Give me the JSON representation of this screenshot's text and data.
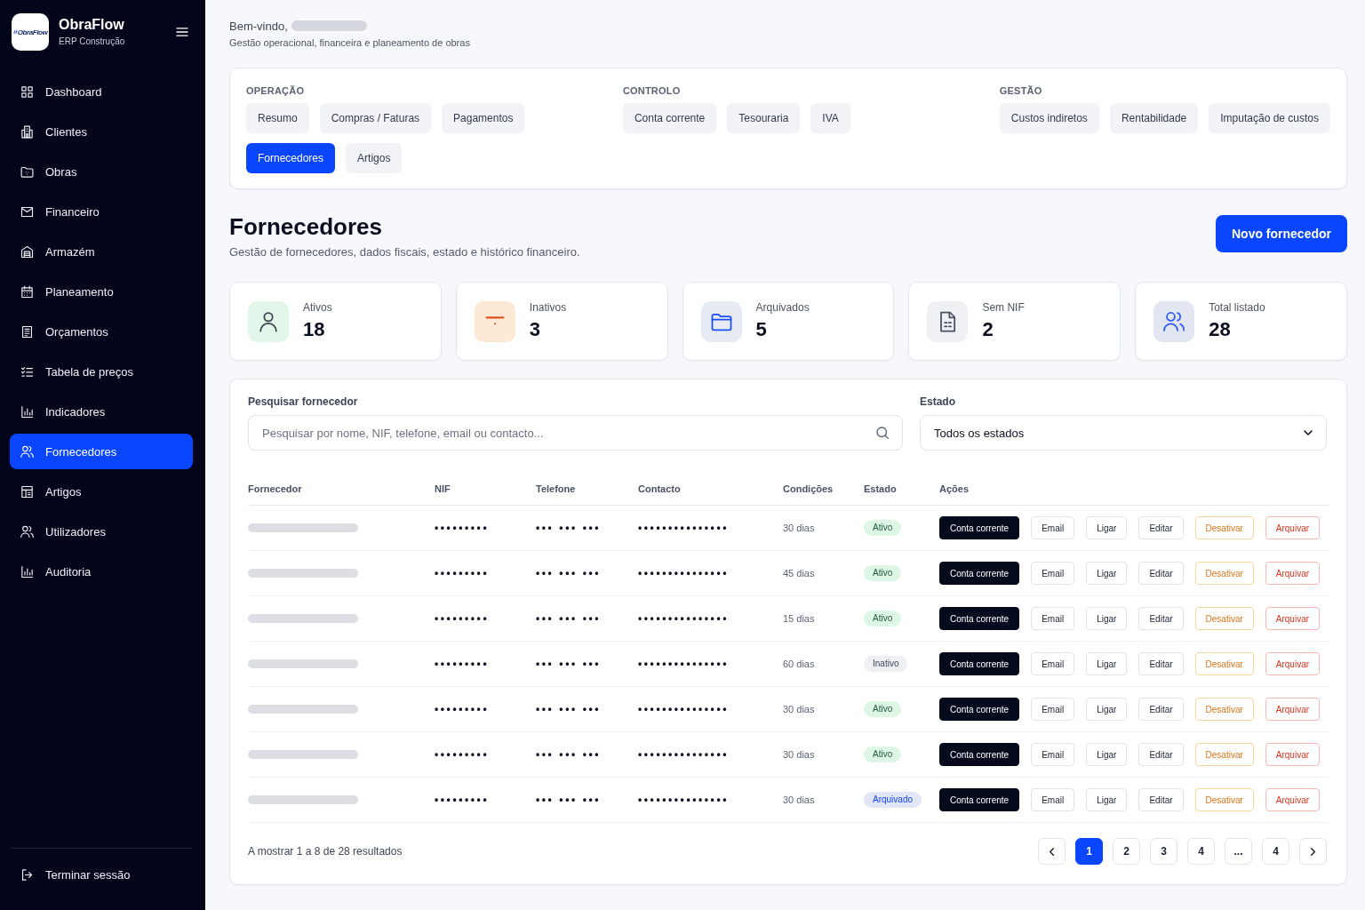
{
  "sidebar": {
    "brand": {
      "logo_text": "ObraFlow",
      "name": "ObraFlow",
      "subtitle": "ERP Construção"
    },
    "items": [
      {
        "label": "Dashboard",
        "selected": false
      },
      {
        "label": "Clientes",
        "selected": false
      },
      {
        "label": "Obras",
        "selected": false
      },
      {
        "label": "Financeiro",
        "selected": false
      },
      {
        "label": "Armazém",
        "selected": false
      },
      {
        "label": "Planeamento",
        "selected": false
      },
      {
        "label": "Orçamentos",
        "selected": false
      },
      {
        "label": "Tabela de preços",
        "selected": false
      },
      {
        "label": "Indicadores",
        "selected": false
      },
      {
        "label": "Fornecedores",
        "selected": true
      },
      {
        "label": "Artigos",
        "selected": false
      },
      {
        "label": "Utilizadores",
        "selected": false
      },
      {
        "label": "Auditoria",
        "selected": false
      }
    ],
    "logout": "Terminar sessão"
  },
  "header": {
    "greeting": "Bem-vindo,",
    "subtitle": "Gestão operacional, financeira e planeamento de obras"
  },
  "nav_groups": [
    {
      "title": "OPERAÇÃO",
      "tabs": [
        {
          "label": "Resumo",
          "selected": false
        },
        {
          "label": "Compras / Faturas",
          "selected": false
        },
        {
          "label": "Pagamentos",
          "selected": false
        },
        {
          "label": "Fornecedores",
          "selected": true
        },
        {
          "label": "Artigos",
          "selected": false
        }
      ]
    },
    {
      "title": "CONTROLO",
      "tabs": [
        {
          "label": "Conta corrente",
          "selected": false
        },
        {
          "label": "Tesouraria",
          "selected": false
        },
        {
          "label": "IVA",
          "selected": false
        }
      ]
    },
    {
      "title": "GESTÃO",
      "tabs": [
        {
          "label": "Custos indiretos",
          "selected": false
        },
        {
          "label": "Rentabilidade",
          "selected": false
        },
        {
          "label": "Imputação de custos",
          "selected": false
        }
      ]
    }
  ],
  "page": {
    "title": "Fornecedores",
    "subtitle": "Gestão de fornecedores, dados fiscais, estado e histórico financeiro.",
    "new_button": "Novo fornecedor"
  },
  "stats": [
    {
      "label": "Ativos",
      "value": "18",
      "kind": "active"
    },
    {
      "label": "Inativos",
      "value": "3",
      "kind": "inactive"
    },
    {
      "label": "Arquivados",
      "value": "5",
      "kind": "archived"
    },
    {
      "label": "Sem NIF",
      "value": "2",
      "kind": "no_nif"
    },
    {
      "label": "Total listado",
      "value": "28",
      "kind": "total"
    }
  ],
  "filters": {
    "search": {
      "label": "Pesquisar fornecedor",
      "placeholder": "Pesquisar por nome, NIF, telefone, email ou contacto..."
    },
    "status": {
      "label": "Estado",
      "value": "Todos os estados"
    }
  },
  "table": {
    "columns": [
      "Fornecedor",
      "NIF",
      "Telefone",
      "Contacto",
      "Condições",
      "Estado",
      "Ações"
    ],
    "rows": [
      {
        "nif": "•••••••••",
        "phone": "••• ••• •••",
        "contact": "•••••••••••••••",
        "terms": "30 dias",
        "status": {
          "label": "Ativo",
          "kind": "active"
        },
        "actions": [
          {
            "label": "Conta corrente",
            "kind": "primary"
          },
          {
            "label": "Email",
            "kind": "outline"
          },
          {
            "label": "Ligar",
            "kind": "outline"
          },
          {
            "label": "Editar",
            "kind": "outline"
          },
          {
            "label": "Desativar",
            "kind": "warning"
          },
          {
            "label": "Arquivar",
            "kind": "danger"
          }
        ]
      },
      {
        "nif": "•••••••••",
        "phone": "••• ••• •••",
        "contact": "•••••••••••••••",
        "terms": "45 dias",
        "status": {
          "label": "Ativo",
          "kind": "active"
        },
        "actions": [
          {
            "label": "Conta corrente",
            "kind": "primary"
          },
          {
            "label": "Email",
            "kind": "outline"
          },
          {
            "label": "Ligar",
            "kind": "outline"
          },
          {
            "label": "Editar",
            "kind": "outline"
          },
          {
            "label": "Desativar",
            "kind": "warning"
          },
          {
            "label": "Arquivar",
            "kind": "danger"
          }
        ]
      },
      {
        "nif": "•••••••••",
        "phone": "••• ••• •••",
        "contact": "•••••••••••••••",
        "terms": "15 dias",
        "status": {
          "label": "Ativo",
          "kind": "active"
        },
        "actions": [
          {
            "label": "Conta corrente",
            "kind": "primary"
          },
          {
            "label": "Email",
            "kind": "outline"
          },
          {
            "label": "Ligar",
            "kind": "outline"
          },
          {
            "label": "Editar",
            "kind": "outline"
          },
          {
            "label": "Desativar",
            "kind": "warning"
          },
          {
            "label": "Arquivar",
            "kind": "danger"
          }
        ]
      },
      {
        "nif": "•••••••••",
        "phone": "••• ••• •••",
        "contact": "•••••••••••••••",
        "terms": "60 dias",
        "status": {
          "label": "Inativo",
          "kind": "inactive"
        },
        "actions": [
          {
            "label": "Conta corrente",
            "kind": "primary"
          },
          {
            "label": "Email",
            "kind": "outline"
          },
          {
            "label": "Ligar",
            "kind": "outline"
          },
          {
            "label": "Editar",
            "kind": "outline"
          },
          {
            "label": "Desativar",
            "kind": "warning"
          },
          {
            "label": "Arquivar",
            "kind": "danger"
          }
        ]
      },
      {
        "nif": "•••••••••",
        "phone": "••• ••• •••",
        "contact": "•••••••••••••••",
        "terms": "30 dias",
        "status": {
          "label": "Ativo",
          "kind": "active"
        },
        "actions": [
          {
            "label": "Conta corrente",
            "kind": "primary"
          },
          {
            "label": "Email",
            "kind": "outline"
          },
          {
            "label": "Ligar",
            "kind": "outline"
          },
          {
            "label": "Editar",
            "kind": "outline"
          },
          {
            "label": "Desativar",
            "kind": "warning"
          },
          {
            "label": "Arquivar",
            "kind": "danger"
          }
        ]
      },
      {
        "nif": "•••••••••",
        "phone": "••• ••• •••",
        "contact": "•••••••••••••••",
        "terms": "30 dias",
        "status": {
          "label": "Ativo",
          "kind": "active"
        },
        "actions": [
          {
            "label": "Conta corrente",
            "kind": "primary"
          },
          {
            "label": "Email",
            "kind": "outline"
          },
          {
            "label": "Ligar",
            "kind": "outline"
          },
          {
            "label": "Editar",
            "kind": "outline"
          },
          {
            "label": "Desativar",
            "kind": "warning"
          },
          {
            "label": "Arquivar",
            "kind": "danger"
          }
        ]
      },
      {
        "nif": "•••••••••",
        "phone": "••• ••• •••",
        "contact": "•••••••••••••••",
        "terms": "30 dias",
        "status": {
          "label": "Arquivado",
          "kind": "archived"
        },
        "actions": [
          {
            "label": "Conta corrente",
            "kind": "primary"
          },
          {
            "label": "Email",
            "kind": "outline"
          },
          {
            "label": "Ligar",
            "kind": "outline"
          },
          {
            "label": "Editar",
            "kind": "outline"
          },
          {
            "label": "Desativar",
            "kind": "warning"
          },
          {
            "label": "Arquivar",
            "kind": "danger"
          }
        ]
      }
    ]
  },
  "pagination": {
    "summary": "A mostrar 1 a 8 de 28 resultados",
    "pages": [
      {
        "label": "1",
        "selected": true
      },
      {
        "label": "2",
        "selected": false
      },
      {
        "label": "3",
        "selected": false
      },
      {
        "label": "4",
        "selected": false
      },
      {
        "label": "...",
        "selected": false
      },
      {
        "label": "4",
        "selected": false
      }
    ]
  }
}
